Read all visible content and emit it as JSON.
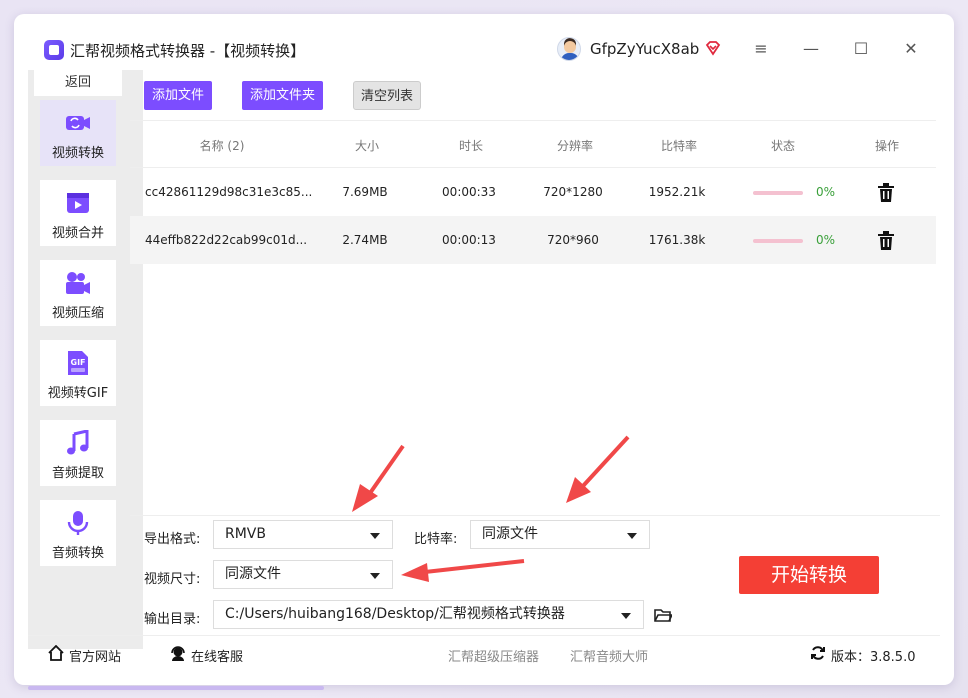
{
  "window": {
    "title": "汇帮视频格式转换器  -【视频转换】",
    "username": "GfpZyYucX8ab",
    "controls": [
      "≡",
      "—",
      "☐",
      "✕"
    ]
  },
  "sidebar": {
    "back_label": "返回",
    "items": [
      {
        "label": "视频转换",
        "icon": "video-convert-icon",
        "active": true
      },
      {
        "label": "视频合并",
        "icon": "video-merge-icon"
      },
      {
        "label": "视频压缩",
        "icon": "video-compress-icon"
      },
      {
        "label": "视频转GIF",
        "icon": "gif-icon"
      },
      {
        "label": "音频提取",
        "icon": "music-note-icon"
      },
      {
        "label": "音频转换",
        "icon": "microphone-icon"
      }
    ]
  },
  "toolbar": {
    "add_file": "添加文件",
    "add_folder": "添加文件夹",
    "clear_list": "清空列表"
  },
  "table": {
    "headers": [
      "名称 (2)",
      "大小",
      "时长",
      "分辨率",
      "比特率",
      "状态",
      "操作"
    ],
    "rows": [
      {
        "name": "cc42861129d98c31e3c85...",
        "size": "7.69MB",
        "duration": "00:00:33",
        "resolution": "720*1280",
        "bitrate": "1952.21k",
        "progress": "0%"
      },
      {
        "name": "44effb822d22cab99c01d...",
        "size": "2.74MB",
        "duration": "00:00:13",
        "resolution": "720*960",
        "bitrate": "1761.38k",
        "progress": "0%"
      }
    ]
  },
  "settings": {
    "format_label": "导出格式:",
    "format_value": "RMVB",
    "bitrate_label": "比特率:",
    "bitrate_value": "同源文件",
    "size_label": "视频尺寸:",
    "size_value": "同源文件",
    "output_label": "输出目录:",
    "output_value": "C:/Users/huibang168/Desktop/汇帮视频格式转换器",
    "start_button": "开始转换"
  },
  "footer": {
    "website": "官方网站",
    "service": "在线客服",
    "link1": "汇帮超级压缩器",
    "link2": "汇帮音频大师",
    "version": "版本：3.8.5.0"
  },
  "colors": {
    "accent": "#7c4dff",
    "start": "#f43f35",
    "arrow": "#f04848"
  }
}
